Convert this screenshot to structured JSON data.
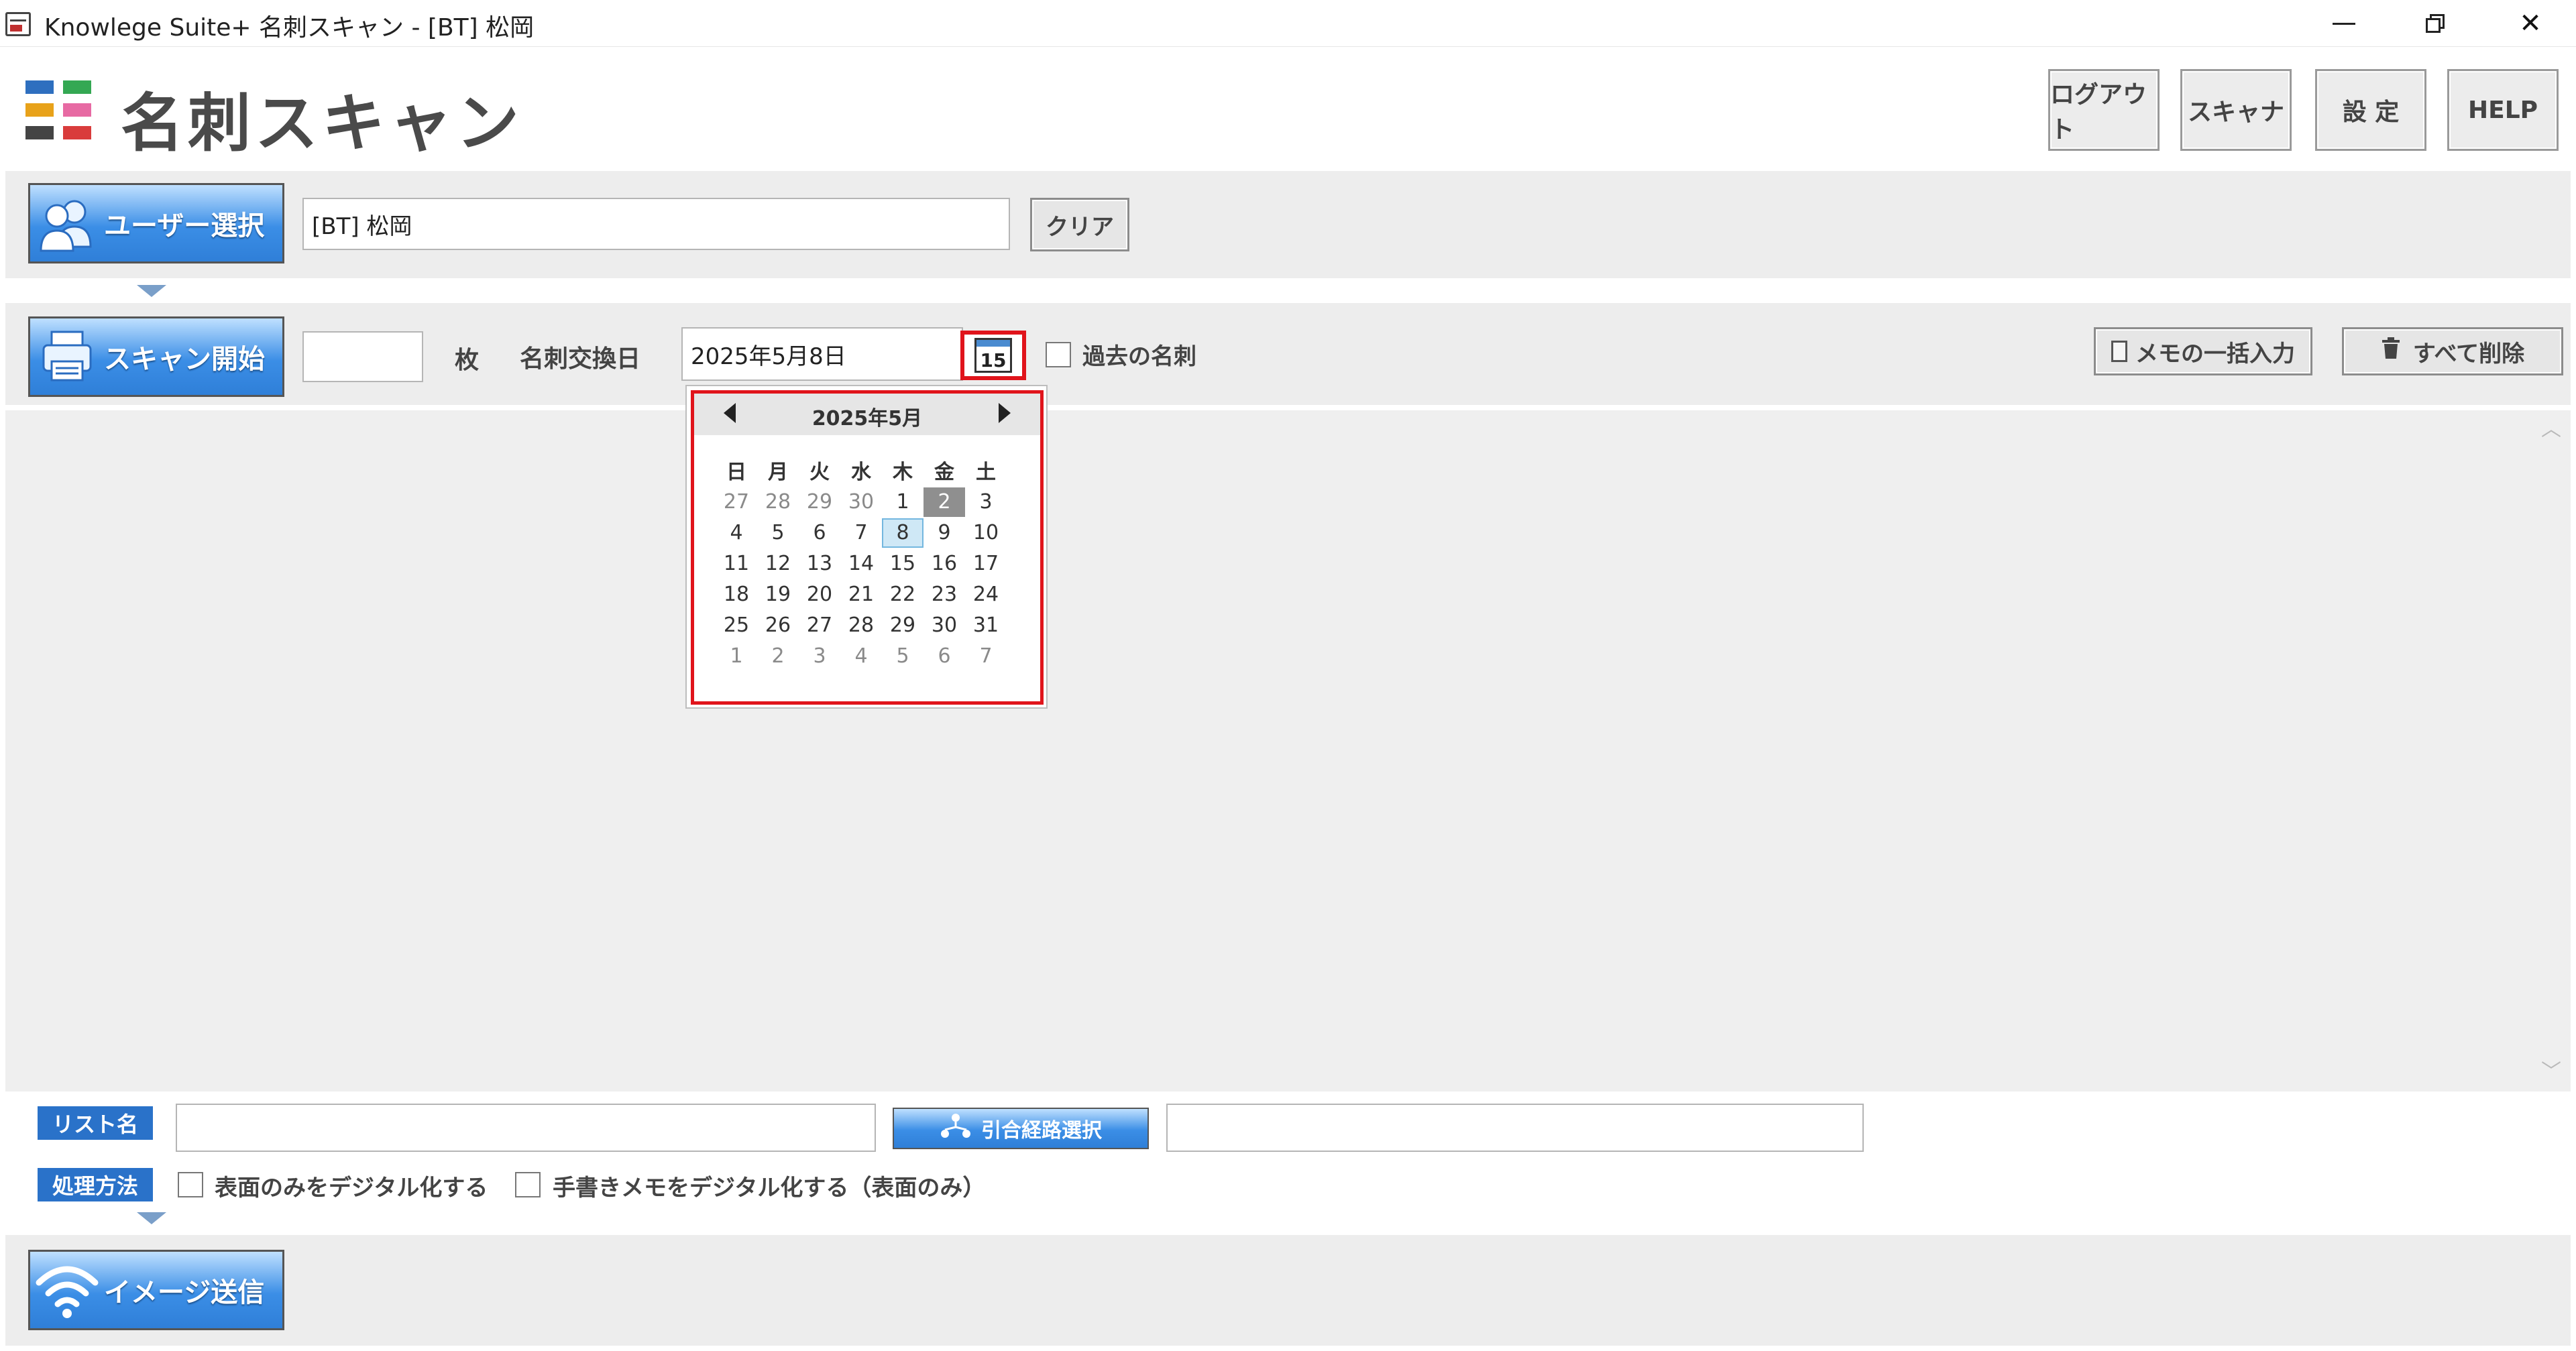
{
  "window": {
    "title": "Knowlege Suite+ 名刺スキャン - [BT] 松岡",
    "controls": {
      "minimize": "minimize",
      "restore": "restore",
      "close": "✕"
    }
  },
  "header": {
    "title": "名刺スキャン",
    "buttons": {
      "logout": "ログアウト",
      "scanner": "スキャナ",
      "settings": "設 定",
      "help": "HELP"
    },
    "logo_colors": [
      "#2e6fbf",
      "#34a853",
      "#e8a21a",
      "#e76aa3",
      "#444444",
      "#d93c3c"
    ]
  },
  "user_panel": {
    "select_button": "ユーザー選択",
    "user_value": "[BT] 松岡",
    "clear_button": "クリア"
  },
  "scan_panel": {
    "scan_button": "スキャン開始",
    "count_value": "",
    "count_unit": "枚",
    "exchange_date_label": "名刺交換日",
    "exchange_date_value": "2025年5月8日",
    "calendar_icon_text": "15",
    "past_cards_label": "過去の名刺",
    "memo_bulk_button": "メモの一括入力",
    "delete_all_button": "すべて削除"
  },
  "calendar": {
    "title": "2025年5月",
    "weekdays": [
      "日",
      "月",
      "火",
      "水",
      "木",
      "金",
      "土"
    ],
    "weeks": [
      [
        "27",
        "28",
        "29",
        "30",
        "1",
        "2",
        "3"
      ],
      [
        "4",
        "5",
        "6",
        "7",
        "8",
        "9",
        "10"
      ],
      [
        "11",
        "12",
        "13",
        "14",
        "15",
        "16",
        "17"
      ],
      [
        "18",
        "19",
        "20",
        "21",
        "22",
        "23",
        "24"
      ],
      [
        "25",
        "26",
        "27",
        "28",
        "29",
        "30",
        "31"
      ],
      [
        "1",
        "2",
        "3",
        "4",
        "5",
        "6",
        "7"
      ]
    ],
    "selected_day": "2",
    "highlighted_day": "8"
  },
  "bottom_panel": {
    "list_name_label": "リスト名",
    "list_name_value": "",
    "route_button": "引合経路選択",
    "route_value": "",
    "process_label": "処理方法",
    "option_front_only": "表面のみをデジタル化する",
    "option_handwritten": "手書きメモをデジタル化する（表面のみ）",
    "send_button": "イメージ送信"
  },
  "colors": {
    "accent_red": "#e0141b",
    "button_blue": "#3b8ee6",
    "tag_blue": "#2a72c9"
  }
}
